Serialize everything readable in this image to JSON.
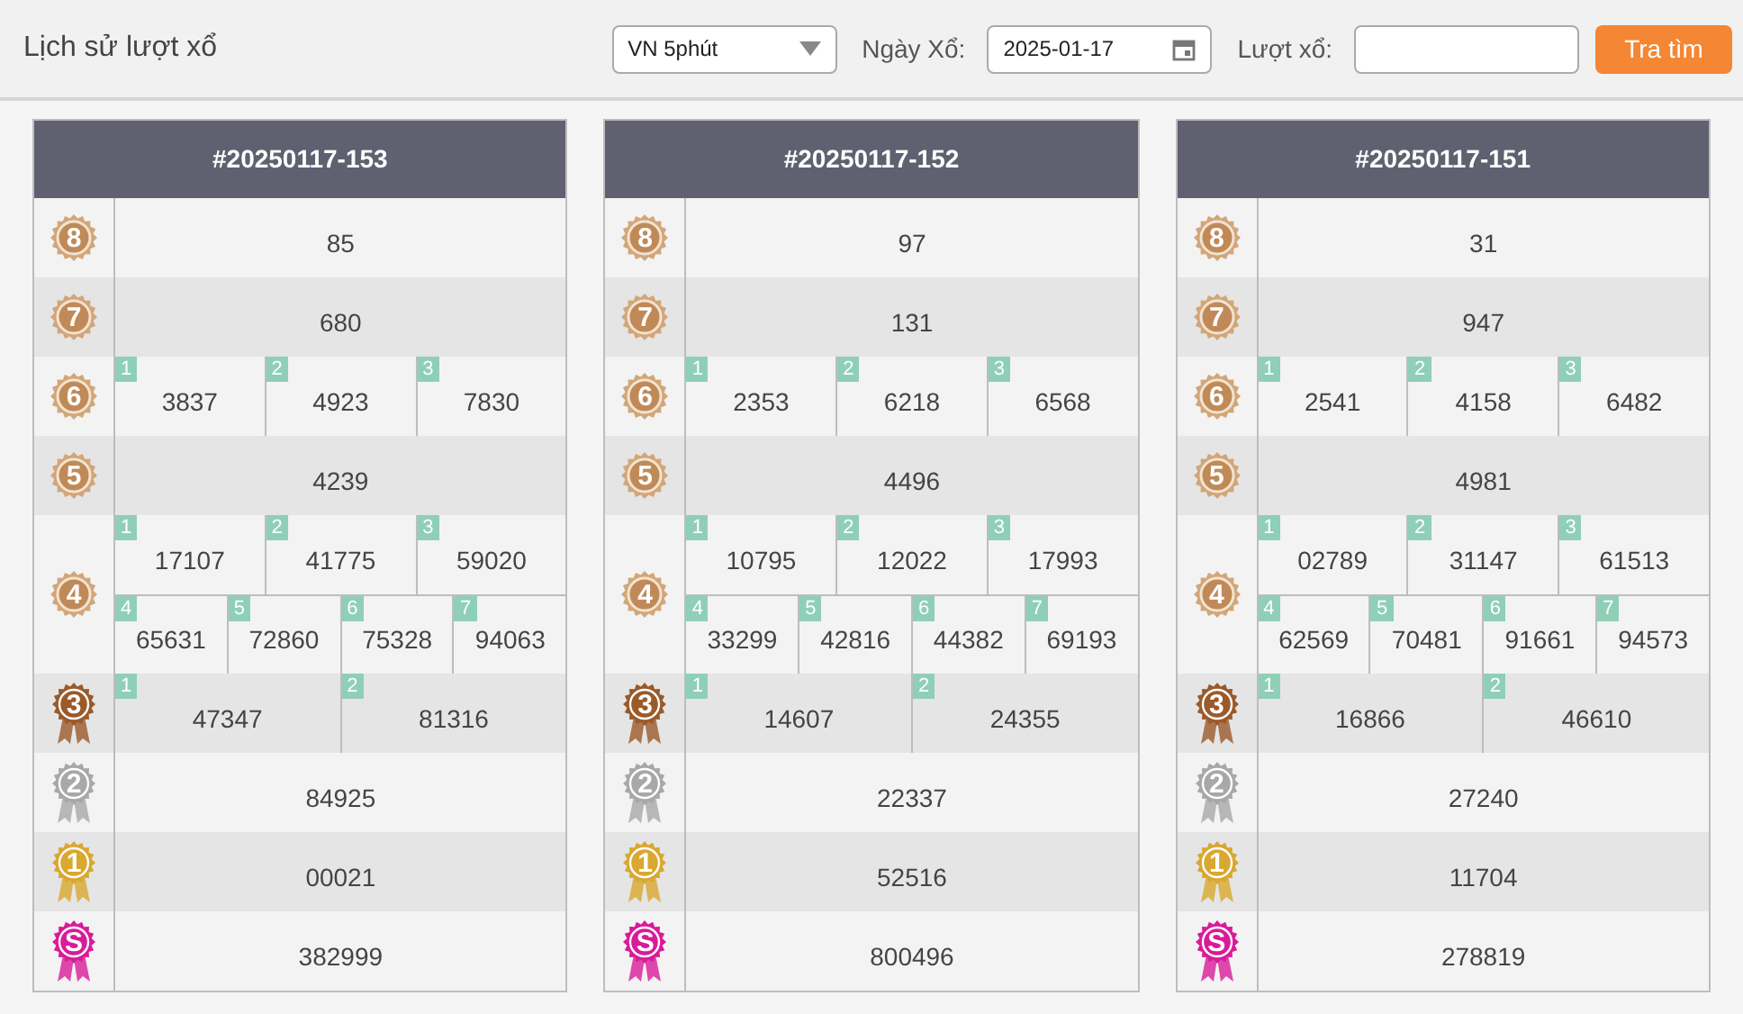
{
  "toolbar": {
    "title": "Lịch sử lượt xổ",
    "game_select": {
      "value": "VN 5phút"
    },
    "date_label": "Ngày Xổ:",
    "date_field": {
      "value": "2025-01-17"
    },
    "round_label": "Lượt xổ:",
    "search_button": "Tra tìm"
  },
  "cards": [
    {
      "title": "#20250117-153",
      "prizes": [
        {
          "rank": "8",
          "kind": "sun",
          "color": "#d2a679",
          "lines": [
            [
              {
                "value": "85"
              }
            ]
          ]
        },
        {
          "rank": "7",
          "kind": "sun",
          "color": "#d2a679",
          "lines": [
            [
              {
                "value": "680"
              }
            ]
          ]
        },
        {
          "rank": "6",
          "kind": "sun",
          "color": "#d2a679",
          "lines": [
            [
              {
                "index": "1",
                "value": "3837"
              },
              {
                "index": "2",
                "value": "4923"
              },
              {
                "index": "3",
                "value": "7830"
              }
            ]
          ]
        },
        {
          "rank": "5",
          "kind": "sun",
          "color": "#d2a679",
          "lines": [
            [
              {
                "value": "4239"
              }
            ]
          ]
        },
        {
          "rank": "4",
          "kind": "sun",
          "color": "#d2a679",
          "lines": [
            [
              {
                "index": "1",
                "value": "17107"
              },
              {
                "index": "2",
                "value": "41775"
              },
              {
                "index": "3",
                "value": "59020"
              }
            ],
            [
              {
                "index": "4",
                "value": "65631"
              },
              {
                "index": "5",
                "value": "72860"
              },
              {
                "index": "6",
                "value": "75328"
              },
              {
                "index": "7",
                "value": "94063"
              }
            ]
          ]
        },
        {
          "rank": "3",
          "kind": "ribbon",
          "color": "#9a5a2a",
          "lines": [
            [
              {
                "index": "1",
                "value": "47347"
              },
              {
                "index": "2",
                "value": "81316"
              }
            ]
          ]
        },
        {
          "rank": "2",
          "kind": "ribbon",
          "color": "#a8a8a8",
          "lines": [
            [
              {
                "value": "84925"
              }
            ]
          ]
        },
        {
          "rank": "1",
          "kind": "ribbon",
          "color": "#d9a830",
          "lines": [
            [
              {
                "value": "00021"
              }
            ]
          ]
        },
        {
          "rank": "S",
          "kind": "ribbon",
          "color": "#d81b9a",
          "lines": [
            [
              {
                "value": "382999"
              }
            ]
          ]
        }
      ]
    },
    {
      "title": "#20250117-152",
      "prizes": [
        {
          "rank": "8",
          "kind": "sun",
          "color": "#d2a679",
          "lines": [
            [
              {
                "value": "97"
              }
            ]
          ]
        },
        {
          "rank": "7",
          "kind": "sun",
          "color": "#d2a679",
          "lines": [
            [
              {
                "value": "131"
              }
            ]
          ]
        },
        {
          "rank": "6",
          "kind": "sun",
          "color": "#d2a679",
          "lines": [
            [
              {
                "index": "1",
                "value": "2353"
              },
              {
                "index": "2",
                "value": "6218"
              },
              {
                "index": "3",
                "value": "6568"
              }
            ]
          ]
        },
        {
          "rank": "5",
          "kind": "sun",
          "color": "#d2a679",
          "lines": [
            [
              {
                "value": "4496"
              }
            ]
          ]
        },
        {
          "rank": "4",
          "kind": "sun",
          "color": "#d2a679",
          "lines": [
            [
              {
                "index": "1",
                "value": "10795"
              },
              {
                "index": "2",
                "value": "12022"
              },
              {
                "index": "3",
                "value": "17993"
              }
            ],
            [
              {
                "index": "4",
                "value": "33299"
              },
              {
                "index": "5",
                "value": "42816"
              },
              {
                "index": "6",
                "value": "44382"
              },
              {
                "index": "7",
                "value": "69193"
              }
            ]
          ]
        },
        {
          "rank": "3",
          "kind": "ribbon",
          "color": "#9a5a2a",
          "lines": [
            [
              {
                "index": "1",
                "value": "14607"
              },
              {
                "index": "2",
                "value": "24355"
              }
            ]
          ]
        },
        {
          "rank": "2",
          "kind": "ribbon",
          "color": "#a8a8a8",
          "lines": [
            [
              {
                "value": "22337"
              }
            ]
          ]
        },
        {
          "rank": "1",
          "kind": "ribbon",
          "color": "#d9a830",
          "lines": [
            [
              {
                "value": "52516"
              }
            ]
          ]
        },
        {
          "rank": "S",
          "kind": "ribbon",
          "color": "#d81b9a",
          "lines": [
            [
              {
                "value": "800496"
              }
            ]
          ]
        }
      ]
    },
    {
      "title": "#20250117-151",
      "prizes": [
        {
          "rank": "8",
          "kind": "sun",
          "color": "#d2a679",
          "lines": [
            [
              {
                "value": "31"
              }
            ]
          ]
        },
        {
          "rank": "7",
          "kind": "sun",
          "color": "#d2a679",
          "lines": [
            [
              {
                "value": "947"
              }
            ]
          ]
        },
        {
          "rank": "6",
          "kind": "sun",
          "color": "#d2a679",
          "lines": [
            [
              {
                "index": "1",
                "value": "2541"
              },
              {
                "index": "2",
                "value": "4158"
              },
              {
                "index": "3",
                "value": "6482"
              }
            ]
          ]
        },
        {
          "rank": "5",
          "kind": "sun",
          "color": "#d2a679",
          "lines": [
            [
              {
                "value": "4981"
              }
            ]
          ]
        },
        {
          "rank": "4",
          "kind": "sun",
          "color": "#d2a679",
          "lines": [
            [
              {
                "index": "1",
                "value": "02789"
              },
              {
                "index": "2",
                "value": "31147"
              },
              {
                "index": "3",
                "value": "61513"
              }
            ],
            [
              {
                "index": "4",
                "value": "62569"
              },
              {
                "index": "5",
                "value": "70481"
              },
              {
                "index": "6",
                "value": "91661"
              },
              {
                "index": "7",
                "value": "94573"
              }
            ]
          ]
        },
        {
          "rank": "3",
          "kind": "ribbon",
          "color": "#9a5a2a",
          "lines": [
            [
              {
                "index": "1",
                "value": "16866"
              },
              {
                "index": "2",
                "value": "46610"
              }
            ]
          ]
        },
        {
          "rank": "2",
          "kind": "ribbon",
          "color": "#a8a8a8",
          "lines": [
            [
              {
                "value": "27240"
              }
            ]
          ]
        },
        {
          "rank": "1",
          "kind": "ribbon",
          "color": "#d9a830",
          "lines": [
            [
              {
                "value": "11704"
              }
            ]
          ]
        },
        {
          "rank": "S",
          "kind": "ribbon",
          "color": "#d81b9a",
          "lines": [
            [
              {
                "value": "278819"
              }
            ]
          ]
        }
      ]
    }
  ]
}
